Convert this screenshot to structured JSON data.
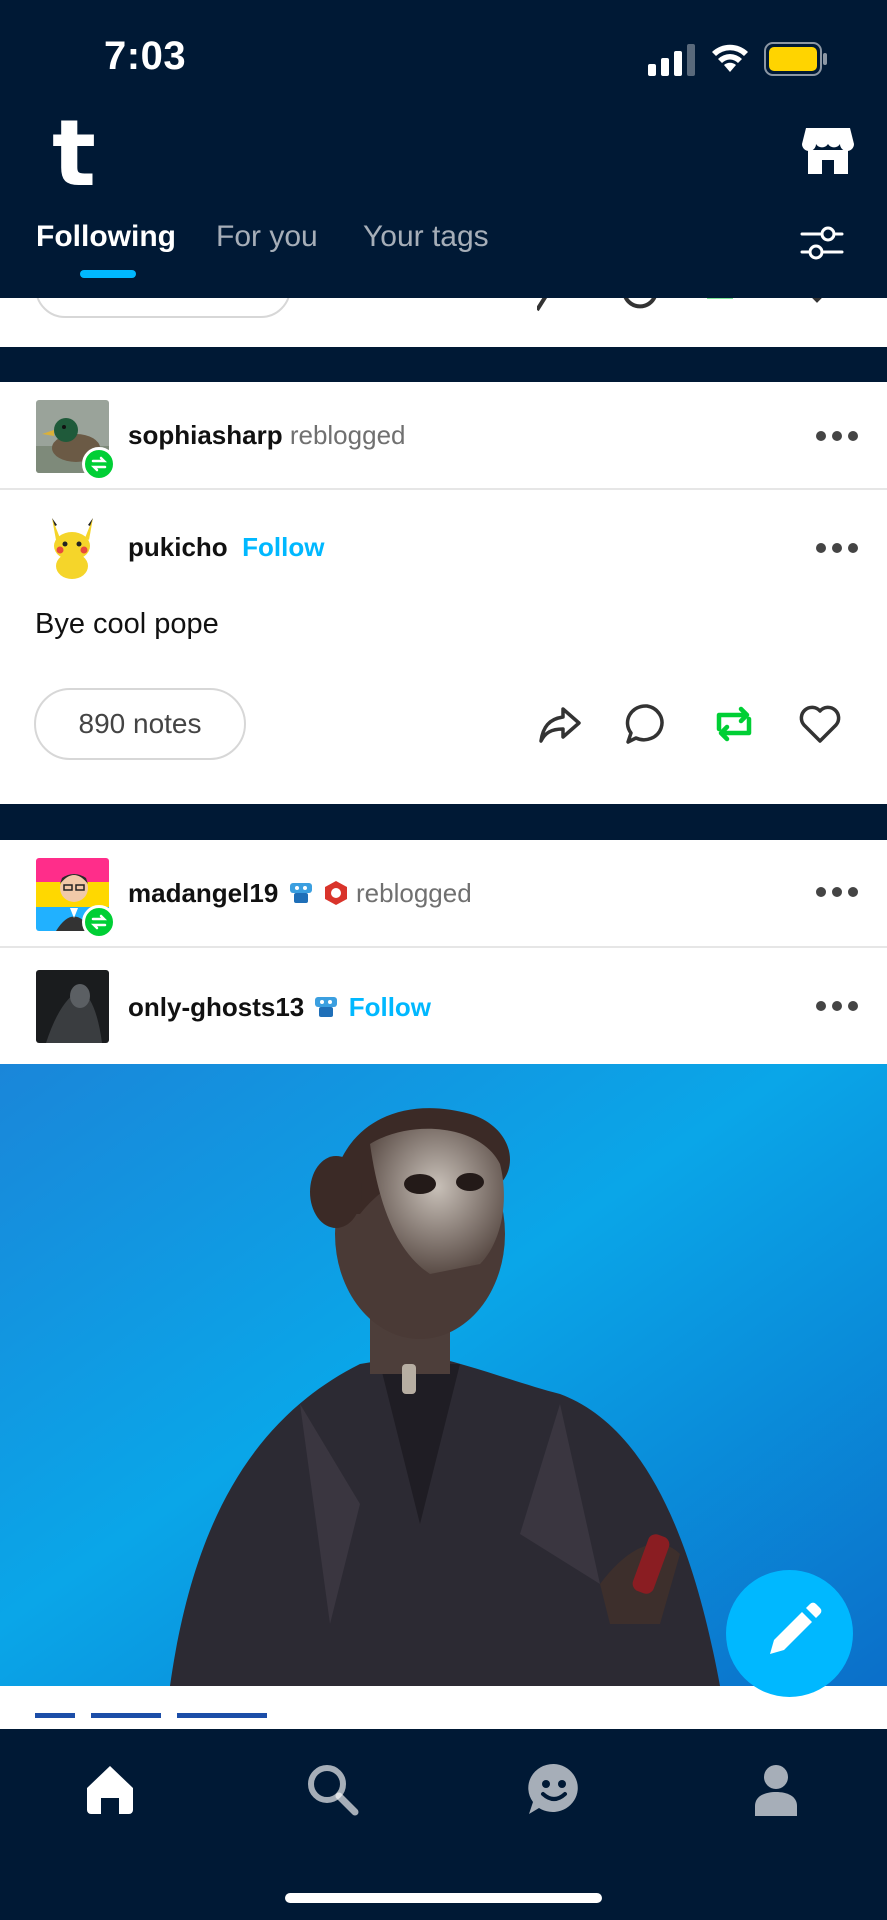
{
  "status_bar": {
    "time": "7:03"
  },
  "header": {
    "logo": "t",
    "tabs": [
      {
        "label": "Following",
        "active": true
      },
      {
        "label": "For you",
        "active": false
      },
      {
        "label": "Your tags",
        "active": false
      }
    ]
  },
  "posts": [
    {
      "reblogger": {
        "name": "sophiasharp",
        "action": "reblogged"
      },
      "author": {
        "name": "pukicho",
        "follow_label": "Follow"
      },
      "text": "Bye cool pope",
      "notes": "890 notes"
    },
    {
      "reblogger": {
        "name": "madangel19",
        "action": "reblogged"
      },
      "author": {
        "name": "only-ghosts13",
        "follow_label": "Follow"
      }
    }
  ],
  "icons": {
    "share": "share-icon",
    "reply": "reply-icon",
    "reblog": "reblog-icon",
    "like": "heart-icon",
    "more": "more-icon",
    "compose": "pencil-icon",
    "nav": [
      "home-icon",
      "search-icon",
      "activity-icon",
      "account-icon"
    ]
  },
  "colors": {
    "navy": "#001935",
    "accent_blue": "#00b8ff",
    "reblog_green": "#00cf35",
    "battery_yellow": "#ffd400"
  }
}
